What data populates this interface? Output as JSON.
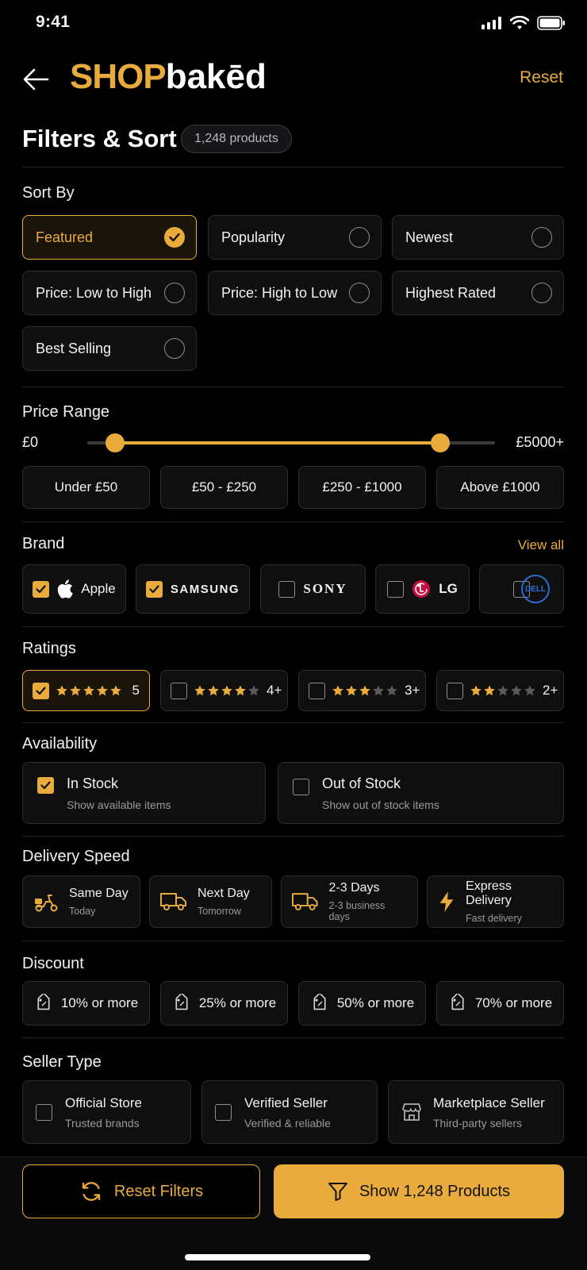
{
  "status": {
    "time": "9:41"
  },
  "header": {
    "logo_shop": "SHOP",
    "logo_baked": "bakēd",
    "reset": "Reset"
  },
  "title": "Filters & Sort",
  "count": "1,248 products",
  "sort": {
    "title": "Sort By",
    "options": [
      {
        "label": "Featured",
        "selected": true
      },
      {
        "label": "Popularity",
        "selected": false
      },
      {
        "label": "Newest",
        "selected": false
      },
      {
        "label": "Price: Low to High",
        "selected": false
      },
      {
        "label": "Price: High to Low",
        "selected": false
      },
      {
        "label": "Highest Rated",
        "selected": false
      },
      {
        "label": "Best Selling",
        "selected": false
      }
    ]
  },
  "price": {
    "title": "Price Range",
    "min": "£0",
    "max": "£5000+",
    "low_value": 0,
    "high_value": 5000,
    "chips": [
      "Under £50",
      "£50 - £250",
      "£250 - £1000",
      "Above £1000"
    ]
  },
  "brand": {
    "title": "Brand",
    "view_all": "View all",
    "items": [
      {
        "label": "Apple",
        "checked": true
      },
      {
        "label": "SAMSUNG",
        "checked": true
      },
      {
        "label": "SONY",
        "checked": false
      },
      {
        "label": "LG",
        "checked": false
      },
      {
        "label": "DELL",
        "checked": false
      }
    ]
  },
  "ratings": {
    "title": "Ratings",
    "items": [
      {
        "label": "5",
        "stars": 5,
        "checked": true
      },
      {
        "label": "4+",
        "stars": 4,
        "checked": false
      },
      {
        "label": "3+",
        "stars": 3,
        "checked": false
      },
      {
        "label": "2+",
        "stars": 2,
        "checked": false
      }
    ]
  },
  "availability": {
    "title": "Availability",
    "items": [
      {
        "label": "In Stock",
        "sub": "Show available items",
        "checked": true
      },
      {
        "label": "Out of Stock",
        "sub": "Show out of stock items",
        "checked": false
      }
    ]
  },
  "delivery": {
    "title": "Delivery Speed",
    "items": [
      {
        "label": "Same Day",
        "sub": "Today",
        "icon": "scooter-icon"
      },
      {
        "label": "Next Day",
        "sub": "Tomorrow",
        "icon": "truck-icon"
      },
      {
        "label": "2-3 Days",
        "sub": "2-3 business days",
        "icon": "truck-icon"
      },
      {
        "label": "Express Delivery",
        "sub": "Fast delivery",
        "icon": "lightning-icon"
      }
    ]
  },
  "discount": {
    "title": "Discount",
    "items": [
      "10% or more",
      "25% or more",
      "50% or more",
      "70% or more"
    ]
  },
  "seller": {
    "title": "Seller Type",
    "items": [
      {
        "label": "Official Store",
        "sub": "Trusted brands",
        "checked": false
      },
      {
        "label": "Verified Seller",
        "sub": "Verified & reliable",
        "checked": false
      },
      {
        "label": "Marketplace Seller",
        "sub": "Third-party sellers",
        "icon": "store-icon"
      }
    ]
  },
  "buttons": {
    "reset": "Reset Filters",
    "show": "Show 1,248 Products"
  },
  "colors": {
    "accent": "#e9ac3c",
    "background": "#000000",
    "card": "#0f0f10"
  }
}
